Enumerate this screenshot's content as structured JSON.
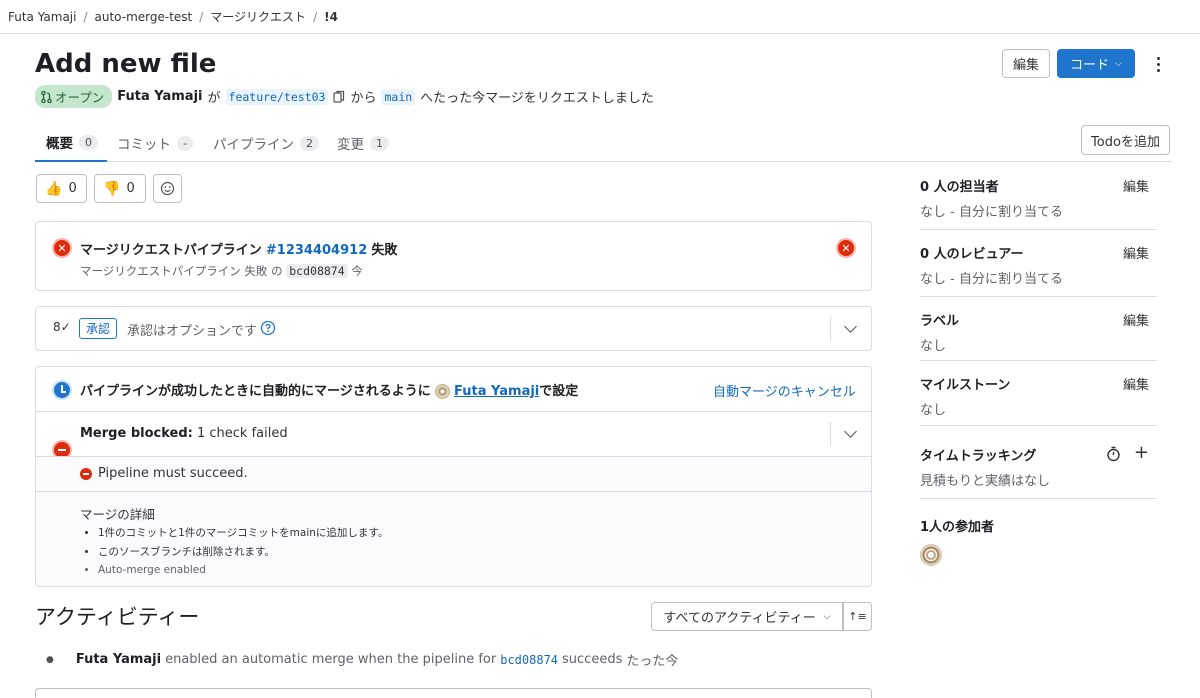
{
  "breadcrumb": {
    "items": [
      "Futa Yamaji",
      "auto-merge-test",
      "マージリクエスト",
      "!4"
    ]
  },
  "header": {
    "title": "Add new file",
    "edit_label": "編集",
    "code_label": "コード",
    "status_label": "オープン",
    "author": "Futa Yamaji",
    "ga": "が",
    "source_branch": "feature/test03",
    "kara": "から",
    "target_branch": "main",
    "suffix": "へたった今マージをリクエストしました"
  },
  "tabs": [
    {
      "label": "概要",
      "count": "0"
    },
    {
      "label": "コミット",
      "count": "-"
    },
    {
      "label": "パイプライン",
      "count": "2"
    },
    {
      "label": "変更",
      "count": "1"
    }
  ],
  "todo_label": "Todoを追加",
  "reactions": {
    "thumbs_up": "0",
    "thumbs_down": "0"
  },
  "pipeline": {
    "title_prefix": "マージリクエストパイプライン",
    "pipeline_id": "#1234404912",
    "status": "失敗",
    "sub_prefix": "マージリクエストパイプライン 失敗 の",
    "commit": "bcd08874",
    "time": "今"
  },
  "approval": {
    "badge": "承認",
    "text": "承認はオプションです"
  },
  "automerge": {
    "text_prefix": "パイプラインが成功したときに自動的にマージされるように",
    "user": "Futa Yamaji",
    "text_suffix": "で設定",
    "cancel_label": "自動マージのキャンセル"
  },
  "merge_blocked": {
    "title": "Merge blocked:",
    "detail": "1 check failed",
    "check": "Pipeline must succeed."
  },
  "merge_details": {
    "heading": "マージの詳細",
    "items": [
      "1件のコミットと1件のマージコミットをmainに追加します。",
      "このソースブランチは削除されます。",
      "Auto-merge enabled"
    ]
  },
  "activity": {
    "heading": "アクティビティー",
    "filter_label": "すべてのアクティビティー",
    "sort_label": "↑≡",
    "entry_user": "Futa Yamaji",
    "entry_text": "enabled an automatic merge when the pipeline for",
    "entry_commit": "bcd08874",
    "entry_suffix": "succeeds",
    "entry_time": "たった今"
  },
  "sidebar": {
    "assignees": {
      "title": "0 人の担当者",
      "edit": "編集",
      "value": "なし - 自分に割り当てる"
    },
    "reviewers": {
      "title": "0 人のレビュアー",
      "edit": "編集",
      "value": "なし - 自分に割り当てる"
    },
    "labels": {
      "title": "ラベル",
      "edit": "編集",
      "value": "なし"
    },
    "milestone": {
      "title": "マイルストーン",
      "edit": "編集",
      "value": "なし"
    },
    "time_tracking": {
      "title": "タイムトラッキング",
      "value": "見積もりと実績はなし"
    },
    "participants": {
      "title": "1人の参加者"
    }
  },
  "colors": {
    "primary": "#1f75cb",
    "danger": "#dd2b0e",
    "success_bg": "#c3e6cd",
    "link": "#1068bf"
  }
}
